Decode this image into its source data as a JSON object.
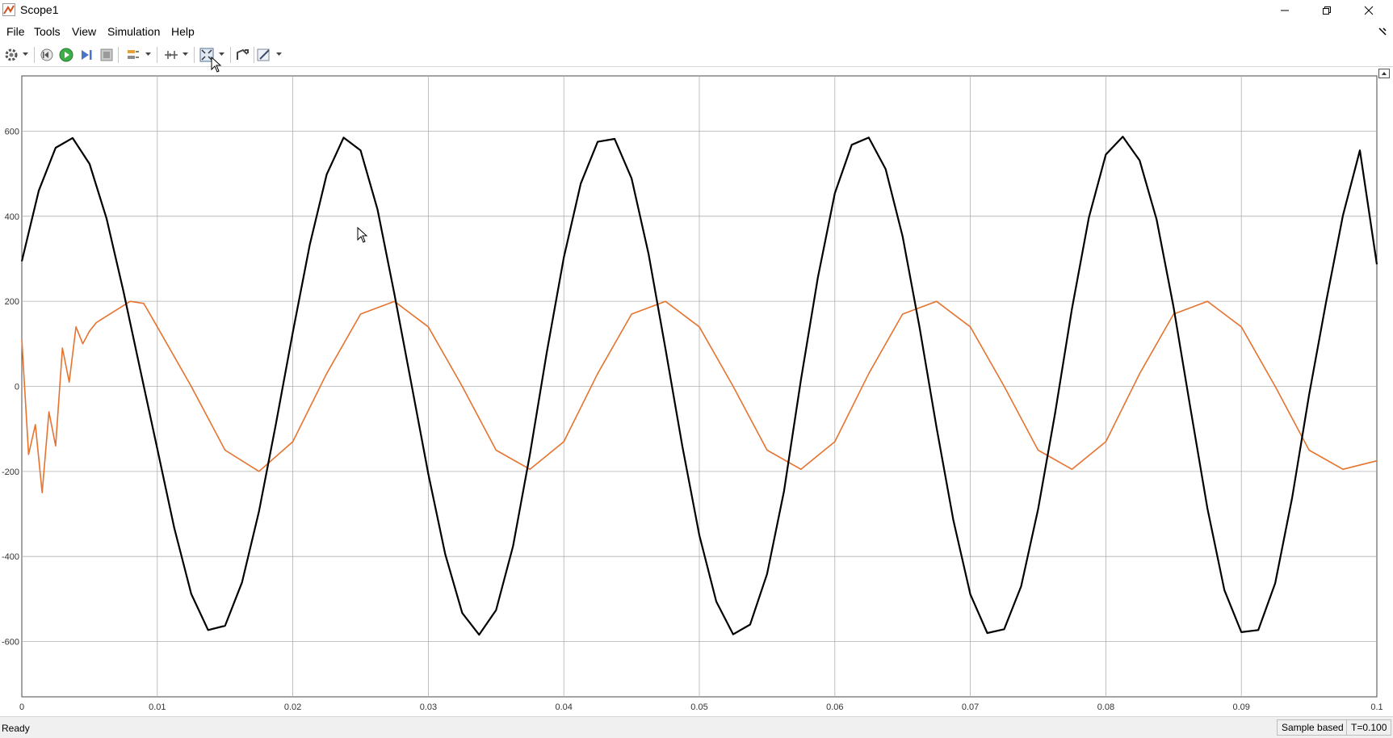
{
  "window": {
    "title": "Scope1",
    "controls": [
      "minimize",
      "restore",
      "close"
    ]
  },
  "menu": {
    "items": [
      "File",
      "Tools",
      "View",
      "Simulation",
      "Help"
    ]
  },
  "toolbar": {
    "icons": [
      "settings-icon",
      "step-back-icon",
      "run-icon",
      "step-forward-icon",
      "stop-icon",
      "highlight-signals-icon",
      "cursor-measurements-icon",
      "zoom-fit-icon",
      "autoscale-icon",
      "style-icon"
    ]
  },
  "status": {
    "left": "Ready",
    "mode": "Sample based",
    "time": "T=0.100"
  },
  "colors": {
    "series1": "#000000",
    "series2": "#e6732e",
    "grid": "#b0b0b0"
  },
  "chart_data": {
    "type": "line",
    "xlim": [
      0,
      0.1
    ],
    "ylim": [
      -730,
      730
    ],
    "xticks": [
      0,
      0.01,
      0.02,
      0.03,
      0.04,
      0.05,
      0.06,
      0.07,
      0.08,
      0.09,
      0.1
    ],
    "xtick_labels": [
      "0",
      "0.01",
      "0.02",
      "0.03",
      "0.04",
      "0.05",
      "0.06",
      "0.07",
      "0.08",
      "0.09",
      "0.1"
    ],
    "yticks": [
      -600,
      -400,
      -200,
      0,
      200,
      400,
      600
    ],
    "ytick_labels": [
      "-600",
      "-400",
      "-200",
      "0",
      "200",
      "400",
      "600"
    ],
    "grid": true,
    "title": "",
    "xlabel": "",
    "ylabel": "",
    "series": [
      {
        "color": "#000000",
        "x": [
          0,
          0.00125,
          0.0025,
          0.00375,
          0.005,
          0.00625,
          0.0075,
          0.00875,
          0.01,
          0.01125,
          0.0125,
          0.01375,
          0.015,
          0.01625,
          0.0175,
          0.01875,
          0.02,
          0.02125,
          0.0225,
          0.02375,
          0.025,
          0.02625,
          0.0275,
          0.02875,
          0.03,
          0.03125,
          0.0325,
          0.03375,
          0.035,
          0.03625,
          0.0375,
          0.03875,
          0.04,
          0.04125,
          0.0425,
          0.04375,
          0.045,
          0.04625,
          0.0475,
          0.04875,
          0.05,
          0.05125,
          0.0525,
          0.05375,
          0.055,
          0.05625,
          0.0575,
          0.05875,
          0.06,
          0.06125,
          0.0625,
          0.06375,
          0.065,
          0.06625,
          0.0675,
          0.06875,
          0.07,
          0.07125,
          0.0725,
          0.07375,
          0.075,
          0.07625,
          0.0775,
          0.07875,
          0.08,
          0.08125,
          0.0825,
          0.08375,
          0.085,
          0.08625,
          0.0875,
          0.08875,
          0.09,
          0.09125,
          0.0925,
          0.09375,
          0.095,
          0.09625,
          0.0975,
          0.09875,
          0.1
        ],
        "y": [
          294,
          460,
          561,
          584,
          523,
          395,
          224,
          38,
          -147,
          -333,
          -488,
          -573,
          -563,
          -461,
          -294,
          -89,
          127,
          333,
          498,
          585,
          555,
          416,
          217,
          6,
          -206,
          -395,
          -533,
          -584,
          -526,
          -376,
          -160,
          81,
          303,
          477,
          575,
          582,
          489,
          312,
          89,
          -141,
          -350,
          -506,
          -583,
          -560,
          -441,
          -246,
          15,
          256,
          454,
          568,
          585,
          511,
          353,
          139,
          -96,
          -315,
          -489,
          -580,
          -571,
          -470,
          -289,
          -64,
          182,
          397,
          545,
          587,
          531,
          392,
          186,
          -53,
          -287,
          -479,
          -578,
          -573,
          -463,
          -262,
          -20,
          198,
          402,
          555,
          287
        ]
      },
      {
        "color": "#e6732e",
        "x": [
          0,
          0.0005,
          0.001,
          0.0015,
          0.002,
          0.0025,
          0.003,
          0.0035,
          0.004,
          0.0045,
          0.005,
          0.0055,
          0.006,
          0.007,
          0.008,
          0.009,
          0.01,
          0.0125,
          0.015,
          0.0175,
          0.02,
          0.0225,
          0.025,
          0.0275,
          0.03,
          0.0325,
          0.035,
          0.0375,
          0.04,
          0.0425,
          0.045,
          0.0475,
          0.05,
          0.0525,
          0.055,
          0.0575,
          0.06,
          0.0625,
          0.065,
          0.0675,
          0.07,
          0.0725,
          0.075,
          0.0775,
          0.08,
          0.0825,
          0.085,
          0.0875,
          0.09,
          0.0925,
          0.095,
          0.0975,
          0.1
        ],
        "y": [
          110,
          -160,
          -90,
          -250,
          -60,
          -140,
          90,
          10,
          140,
          100,
          130,
          150,
          160,
          180,
          200,
          195,
          140,
          0,
          -150,
          -200,
          -130,
          30,
          170,
          200,
          140,
          0,
          -150,
          -195,
          -130,
          30,
          170,
          200,
          140,
          0,
          -150,
          -195,
          -130,
          30,
          170,
          200,
          140,
          0,
          -150,
          -195,
          -130,
          30,
          170,
          200,
          140,
          0,
          -150,
          -195,
          -175
        ]
      }
    ]
  }
}
